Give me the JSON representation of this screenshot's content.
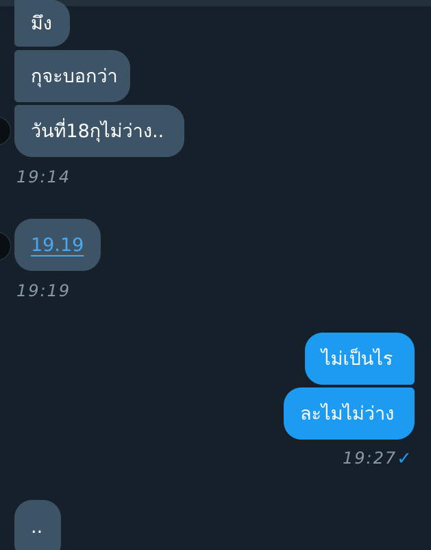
{
  "messages": [
    {
      "text": "มึง",
      "direction": "in"
    },
    {
      "text": "กุจะบอกว่า",
      "direction": "in"
    },
    {
      "text": "วันที่18กุไม่ว่าง..",
      "direction": "in"
    },
    {
      "text": "19.19",
      "direction": "in",
      "is_link": true
    },
    {
      "text": "ไม่เป็นไร",
      "direction": "out"
    },
    {
      "text": "ละไมไม่ว่าง",
      "direction": "out"
    },
    {
      "text": "..",
      "direction": "in"
    }
  ],
  "timestamps": {
    "group1": "19:14",
    "group2": "19:19",
    "group3": "19:27"
  },
  "status": {
    "read_icon": "check-icon",
    "check_glyph": "✓"
  },
  "colors": {
    "background": "#15202b",
    "incoming_bubble": "#3d5466",
    "outgoing_bubble": "#1d9bf0",
    "link": "#4aa9ef",
    "timestamp": "#8899a6"
  }
}
